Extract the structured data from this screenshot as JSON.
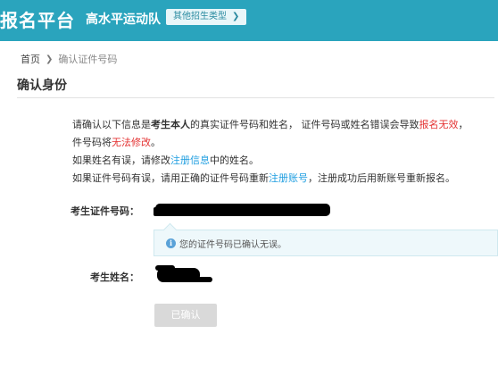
{
  "header": {
    "brand": "报名平台",
    "subtitle": "高水平运动队",
    "other_types_label": "其他招生类型"
  },
  "breadcrumb": {
    "home": "首页",
    "current": "确认证件号码"
  },
  "page_title": "确认身份",
  "notice": {
    "line1_a": "请确认以下信息是",
    "line1_b": "考生本人",
    "line1_c": "的真实证件号码和姓名， 证件号码或姓名错误会导致",
    "line1_d": "报名无效",
    "line1_e": "，",
    "line2_a": "件号码将",
    "line2_b": "无法修改",
    "line2_c": "。",
    "line3_a": "如果姓名有误，请修改",
    "line3_link": "注册信息",
    "line3_b": "中的姓名。",
    "line4_a": "如果证件号码有误，请用正确的证件号码重新",
    "line4_link": "注册账号",
    "line4_b": "，注册成功后用新账号重新报名。"
  },
  "form": {
    "id_label": "考生证件号码：",
    "name_label": "考生姓名："
  },
  "info_message": "您的证件号码已确认无误。",
  "confirmed_button": "已确认",
  "icons": {
    "breadcrumb_separator": "chevron-right-icon",
    "info": "info-icon",
    "other_types_arrow": "chevron-right-icon"
  },
  "colors": {
    "header_bg": "#2aa4bd",
    "warning_red": "#e43333",
    "link_blue": "#1f9ee0",
    "info_bg": "#eef8fb",
    "disabled_button": "#d9d9d9"
  }
}
